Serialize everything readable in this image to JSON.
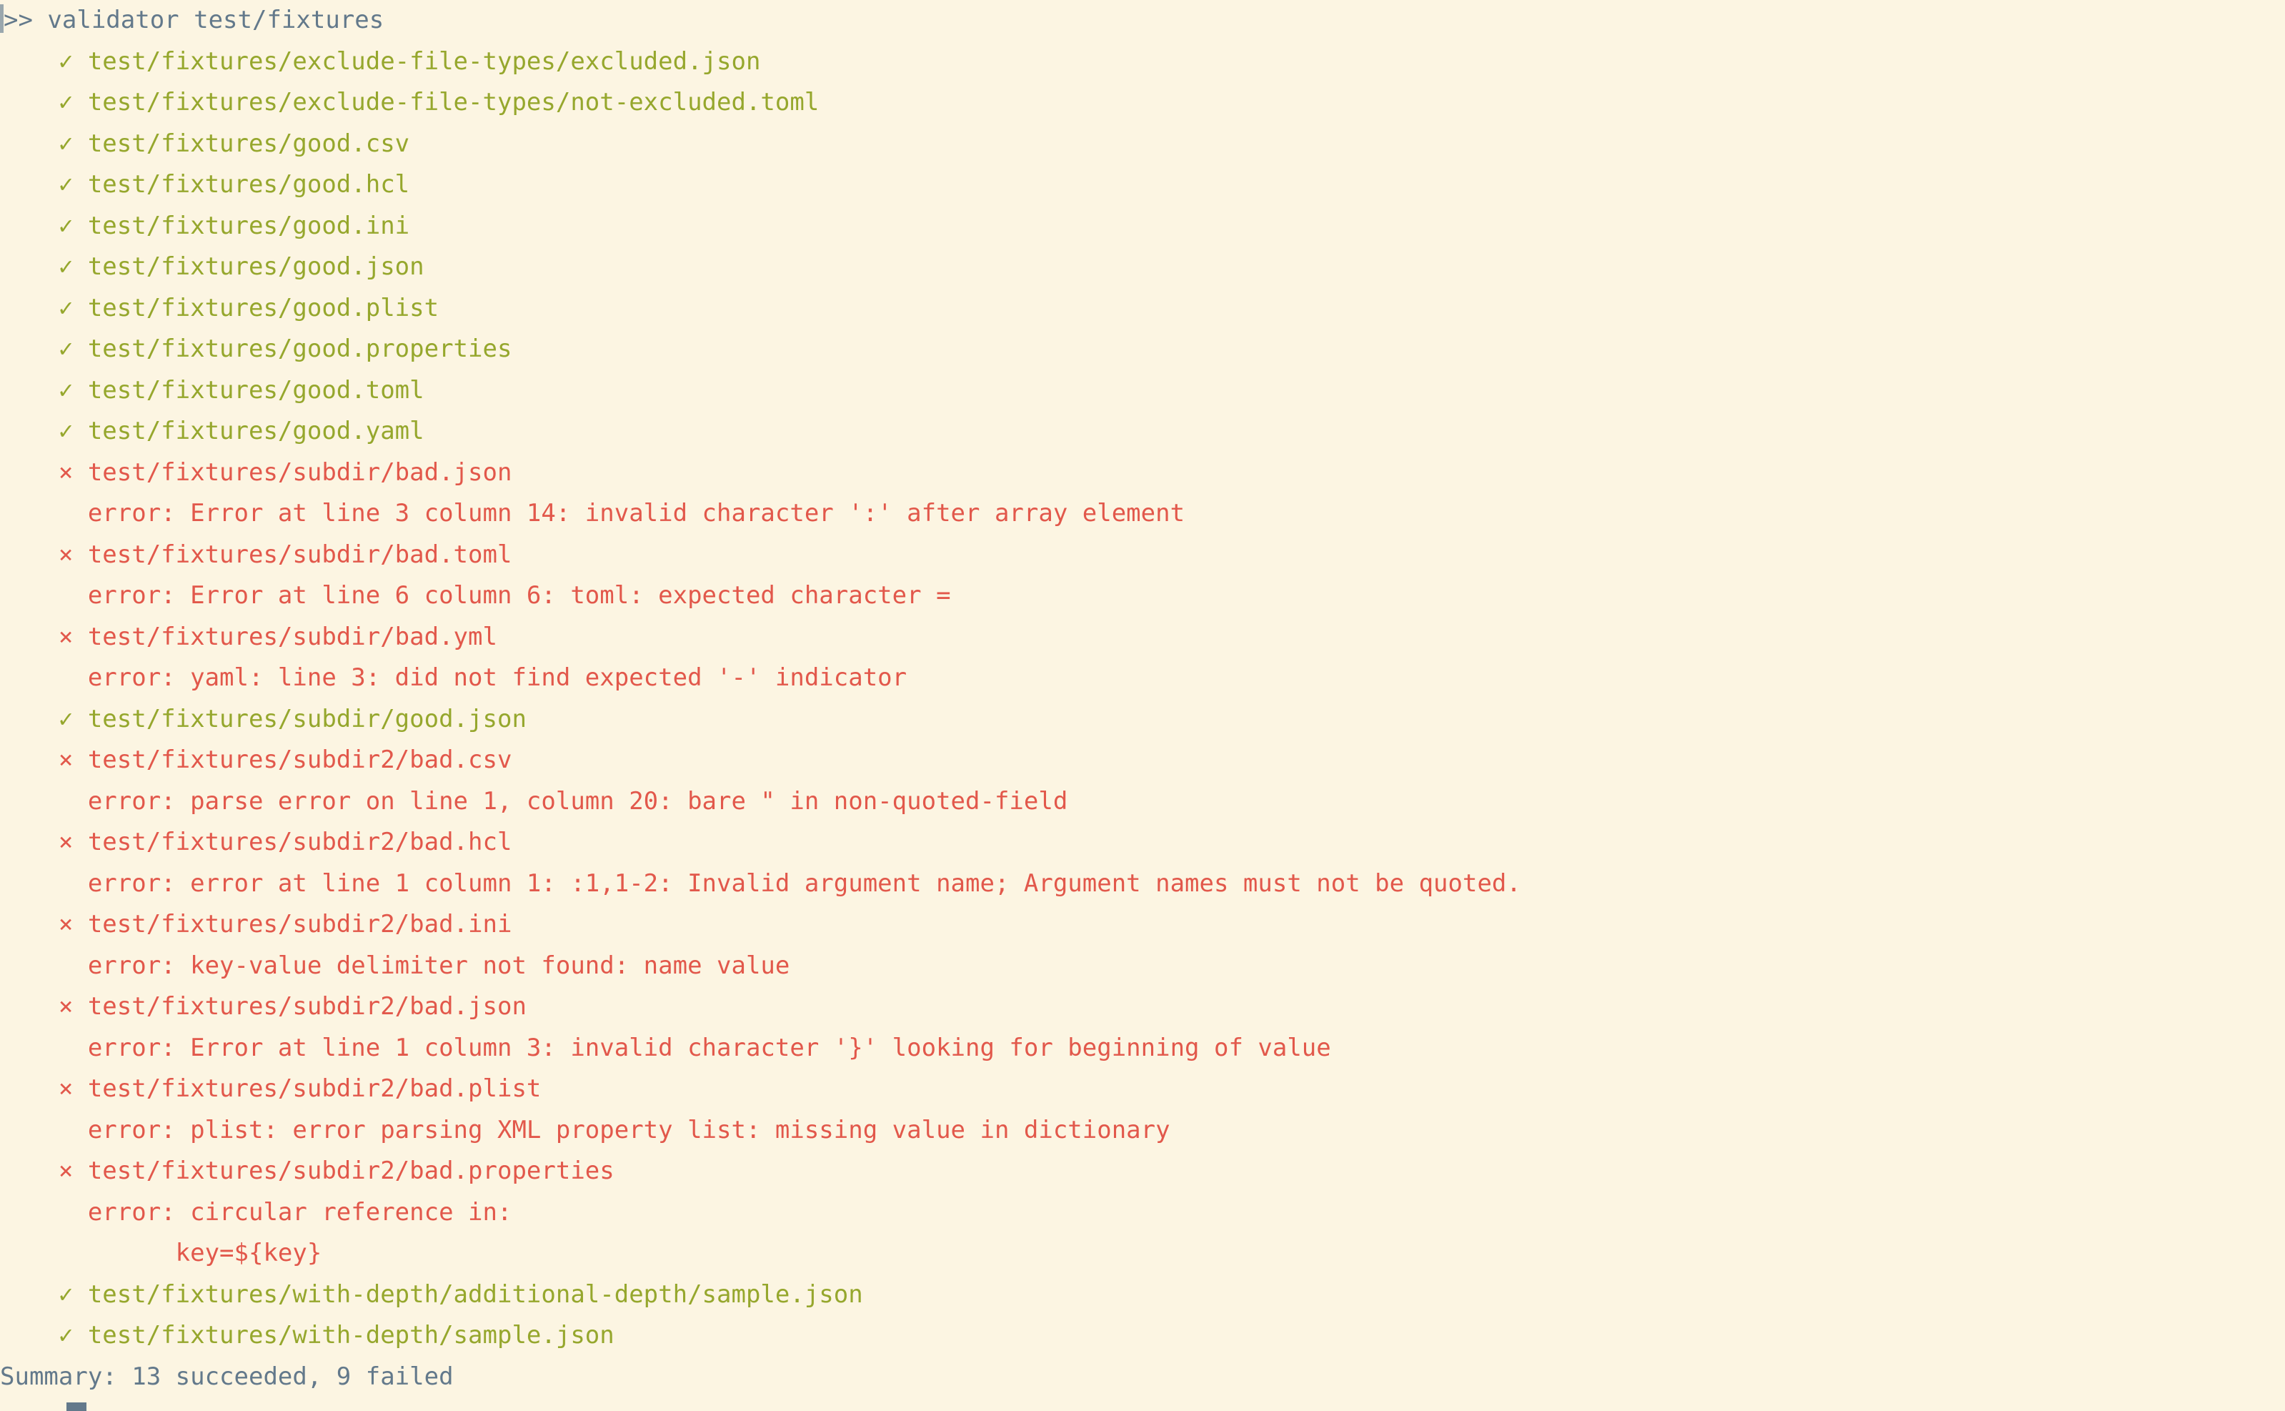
{
  "terminal": {
    "background_color": "#fcf5e2",
    "prompt_color": "#63798b",
    "success_color": "#96a72d",
    "failure_color": "#e2584b",
    "prompt_symbol": ">>",
    "command": "validator test/fixtures",
    "prompt_line": ">> validator test/fixtures",
    "success_icon": "check-mark",
    "failure_icon": "cross-mark",
    "success_glyph": "✓",
    "failure_glyph": "×",
    "results": [
      {
        "status": "ok",
        "glyph": "✓",
        "path": "test/fixtures/exclude-file-types/excluded.json",
        "text": "    ✓ test/fixtures/exclude-file-types/excluded.json"
      },
      {
        "status": "ok",
        "glyph": "✓",
        "path": "test/fixtures/exclude-file-types/not-excluded.toml",
        "text": "    ✓ test/fixtures/exclude-file-types/not-excluded.toml"
      },
      {
        "status": "ok",
        "glyph": "✓",
        "path": "test/fixtures/good.csv",
        "text": "    ✓ test/fixtures/good.csv"
      },
      {
        "status": "ok",
        "glyph": "✓",
        "path": "test/fixtures/good.hcl",
        "text": "    ✓ test/fixtures/good.hcl"
      },
      {
        "status": "ok",
        "glyph": "✓",
        "path": "test/fixtures/good.ini",
        "text": "    ✓ test/fixtures/good.ini"
      },
      {
        "status": "ok",
        "glyph": "✓",
        "path": "test/fixtures/good.json",
        "text": "    ✓ test/fixtures/good.json"
      },
      {
        "status": "ok",
        "glyph": "✓",
        "path": "test/fixtures/good.plist",
        "text": "    ✓ test/fixtures/good.plist"
      },
      {
        "status": "ok",
        "glyph": "✓",
        "path": "test/fixtures/good.properties",
        "text": "    ✓ test/fixtures/good.properties"
      },
      {
        "status": "ok",
        "glyph": "✓",
        "path": "test/fixtures/good.toml",
        "text": "    ✓ test/fixtures/good.toml"
      },
      {
        "status": "ok",
        "glyph": "✓",
        "path": "test/fixtures/good.yaml",
        "text": "    ✓ test/fixtures/good.yaml"
      },
      {
        "status": "fail",
        "glyph": "×",
        "path": "test/fixtures/subdir/bad.json",
        "text": "    × test/fixtures/subdir/bad.json"
      },
      {
        "status": "error",
        "text": "      error: Error at line 3 column 14: invalid character ':' after array element"
      },
      {
        "status": "fail",
        "glyph": "×",
        "path": "test/fixtures/subdir/bad.toml",
        "text": "    × test/fixtures/subdir/bad.toml"
      },
      {
        "status": "error",
        "text": "      error: Error at line 6 column 6: toml: expected character ="
      },
      {
        "status": "fail",
        "glyph": "×",
        "path": "test/fixtures/subdir/bad.yml",
        "text": "    × test/fixtures/subdir/bad.yml"
      },
      {
        "status": "error",
        "text": "      error: yaml: line 3: did not find expected '-' indicator"
      },
      {
        "status": "ok",
        "glyph": "✓",
        "path": "test/fixtures/subdir/good.json",
        "text": "    ✓ test/fixtures/subdir/good.json"
      },
      {
        "status": "fail",
        "glyph": "×",
        "path": "test/fixtures/subdir2/bad.csv",
        "text": "    × test/fixtures/subdir2/bad.csv"
      },
      {
        "status": "error",
        "text": "      error: parse error on line 1, column 20: bare \" in non-quoted-field"
      },
      {
        "status": "fail",
        "glyph": "×",
        "path": "test/fixtures/subdir2/bad.hcl",
        "text": "    × test/fixtures/subdir2/bad.hcl"
      },
      {
        "status": "error",
        "text": "      error: error at line 1 column 1: :1,1-2: Invalid argument name; Argument names must not be quoted."
      },
      {
        "status": "fail",
        "glyph": "×",
        "path": "test/fixtures/subdir2/bad.ini",
        "text": "    × test/fixtures/subdir2/bad.ini"
      },
      {
        "status": "error",
        "text": "      error: key-value delimiter not found: name value"
      },
      {
        "status": "fail",
        "glyph": "×",
        "path": "test/fixtures/subdir2/bad.json",
        "text": "    × test/fixtures/subdir2/bad.json"
      },
      {
        "status": "error",
        "text": "      error: Error at line 1 column 3: invalid character '}' looking for beginning of value"
      },
      {
        "status": "fail",
        "glyph": "×",
        "path": "test/fixtures/subdir2/bad.plist",
        "text": "    × test/fixtures/subdir2/bad.plist"
      },
      {
        "status": "error",
        "text": "      error: plist: error parsing XML property list: missing value in dictionary"
      },
      {
        "status": "fail",
        "glyph": "×",
        "path": "test/fixtures/subdir2/bad.properties",
        "text": "    × test/fixtures/subdir2/bad.properties"
      },
      {
        "status": "error",
        "text": "      error: circular reference in:"
      },
      {
        "status": "error",
        "text": "            key=${key}"
      },
      {
        "status": "ok",
        "glyph": "✓",
        "path": "test/fixtures/with-depth/additional-depth/sample.json",
        "text": "    ✓ test/fixtures/with-depth/additional-depth/sample.json"
      },
      {
        "status": "ok",
        "glyph": "✓",
        "path": "test/fixtures/with-depth/sample.json",
        "text": "    ✓ test/fixtures/with-depth/sample.json"
      }
    ],
    "summary": {
      "text": "Summary: 13 succeeded, 9 failed",
      "succeeded": 13,
      "failed": 9
    }
  }
}
